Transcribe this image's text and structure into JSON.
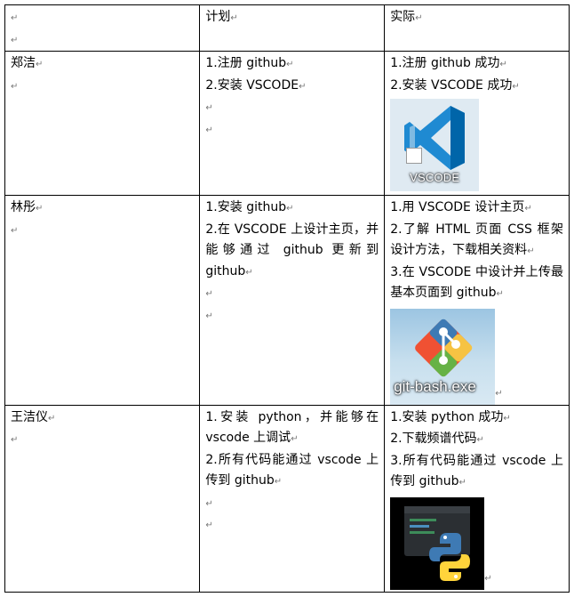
{
  "header": {
    "col1": "",
    "col2": "计划",
    "col3": "实际"
  },
  "rows": [
    {
      "name": "郑洁",
      "plan": [
        "1.注册 github",
        "2.安装 VSCODE"
      ],
      "actual": [
        "1.注册 github 成功",
        "2.安装 VSCODE 成功"
      ],
      "icon": {
        "name": "vscode-icon",
        "label": "VSCODE"
      }
    },
    {
      "name": "林彤",
      "plan": [
        "1.安装 github",
        "2.在 VSCODE 上设计主页，并能够通过 github 更新到 github"
      ],
      "actual": [
        "1.用 VSCODE 设计主页",
        "2.了解 HTML 页面 CSS 框架设计方法，下载相关资料",
        "3.在 VSCODE 中设计并上传最基本页面到 github"
      ],
      "icon": {
        "name": "git-bash-icon",
        "label": "git-bash.exe"
      }
    },
    {
      "name": "王洁仪",
      "plan": [
        "1.安装 python，并能够在 vscode 上调试",
        "2.所有代码能通过 vscode 上传到 github"
      ],
      "actual": [
        "1.安装 python 成功",
        "2.下载频谱代码",
        "3.所有代码能通过 vscode 上传到 github"
      ],
      "icon": {
        "name": "python-icon",
        "label": ""
      }
    }
  ],
  "colors": {
    "vscode_blue": "#1f8ad2",
    "git_red": "#f05133",
    "python_blue": "#3e7ab4",
    "python_yellow": "#ffd43b"
  }
}
